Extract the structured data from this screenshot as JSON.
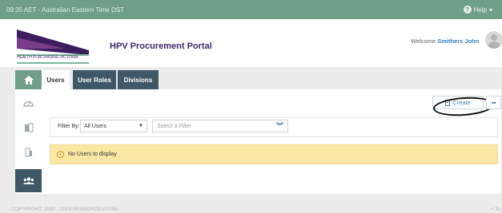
{
  "topbar": {
    "time": "09:35 AET - Australian Eastern Time DST",
    "help_label": "Help"
  },
  "header": {
    "logo_text": "HEALTH PURCHASING VICTORIA",
    "portal_title": "HPV Procurement Portal",
    "welcome": "Welcome",
    "user_name": "Smithers John"
  },
  "tabs": [
    {
      "label": "Users"
    },
    {
      "label": "User Roles"
    },
    {
      "label": "Divisions"
    }
  ],
  "toolbar": {
    "create_label": "Create",
    "more_label": "••"
  },
  "filter": {
    "label": "Filter By:",
    "selected": "All Users",
    "placeholder": "Select a Filter"
  },
  "alert": {
    "message": "No Users to display"
  },
  "footer": {
    "copyright": "-- COPYRIGHT 2000 - 2016 BRAVOSOLUTION --",
    "right": "+ To"
  },
  "colors": {
    "topbar": "#6f9f87",
    "dark_tab": "#3f5865",
    "accent_link": "#3b7fb6",
    "alert_bg": "#fbe7a5",
    "brand_purple": "#4a2a66"
  }
}
